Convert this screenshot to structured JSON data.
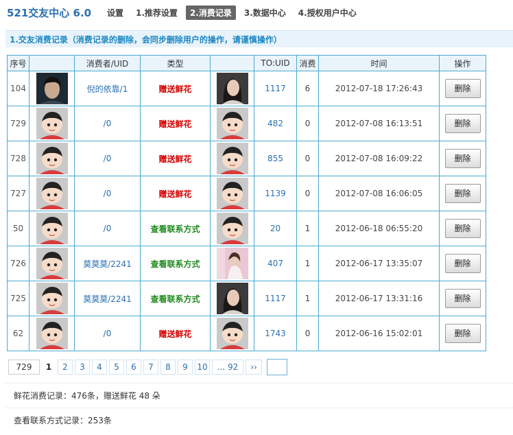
{
  "app": {
    "title": "521交友中心 6.0"
  },
  "nav": [
    {
      "label": "设置",
      "active": false
    },
    {
      "label": "1.推荐设置",
      "active": false
    },
    {
      "label": "2.消费记录",
      "active": true
    },
    {
      "label": "3.数据中心",
      "active": false
    },
    {
      "label": "4.授权用户中心",
      "active": false
    }
  ],
  "section": {
    "title": "1.交友消费记录（消费记录的删除，会同步删除用户的操作，请谨慎操作）"
  },
  "table": {
    "headers": [
      "序号",
      "",
      "消费者/UID",
      "类型",
      "",
      "TO:UID",
      "消费",
      "时间",
      "操作"
    ],
    "rows": [
      {
        "id": "104",
        "avatar": "photo-male",
        "user": "倪的依靠/1",
        "type": "赠送鲜花",
        "type_kind": "flower",
        "to_avatar": "photo-female",
        "touid": "1117",
        "amount": "6",
        "time": "2012-07-18 17:26:43",
        "action": "删除"
      },
      {
        "id": "729",
        "avatar": "cartoon-default",
        "user": "/0",
        "type": "赠送鲜花",
        "type_kind": "flower",
        "to_avatar": "cartoon-default",
        "touid": "482",
        "amount": "0",
        "time": "2012-07-08 16:13:51",
        "action": "删除"
      },
      {
        "id": "728",
        "avatar": "cartoon-default",
        "user": "/0",
        "type": "赠送鲜花",
        "type_kind": "flower",
        "to_avatar": "cartoon-default",
        "touid": "855",
        "amount": "0",
        "time": "2012-07-08 16:09:22",
        "action": "删除"
      },
      {
        "id": "727",
        "avatar": "cartoon-default",
        "user": "/0",
        "type": "赠送鲜花",
        "type_kind": "flower",
        "to_avatar": "cartoon-default",
        "touid": "1139",
        "amount": "0",
        "time": "2012-07-08 16:06:05",
        "action": "删除"
      },
      {
        "id": "50",
        "avatar": "cartoon-default",
        "user": "/0",
        "type": "查看联系方式",
        "type_kind": "contact",
        "to_avatar": "cartoon-default",
        "touid": "20",
        "amount": "1",
        "time": "2012-06-18 06:55:20",
        "action": "删除"
      },
      {
        "id": "726",
        "avatar": "cartoon-default",
        "user": "莫莫莫/2241",
        "type": "查看联系方式",
        "type_kind": "contact",
        "to_avatar": "photo-pink",
        "touid": "407",
        "amount": "1",
        "time": "2012-06-17 13:35:07",
        "action": "删除"
      },
      {
        "id": "725",
        "avatar": "cartoon-default",
        "user": "莫莫莫/2241",
        "type": "查看联系方式",
        "type_kind": "contact",
        "to_avatar": "photo-female",
        "touid": "1117",
        "amount": "1",
        "time": "2012-06-17 13:31:16",
        "action": "删除"
      },
      {
        "id": "62",
        "avatar": "cartoon-default",
        "user": "/0",
        "type": "赠送鲜花",
        "type_kind": "flower",
        "to_avatar": "cartoon-default",
        "touid": "1743",
        "amount": "0",
        "time": "2012-06-16 15:02:01",
        "action": "删除"
      }
    ]
  },
  "pagination": {
    "total": "729",
    "pages": [
      "1",
      "2",
      "3",
      "4",
      "5",
      "6",
      "7",
      "8",
      "9",
      "10",
      "... 92"
    ],
    "current": "1",
    "next": "››"
  },
  "stats": {
    "flowers": "鲜花消费记录：476条，赠送鲜花 48 朵",
    "contacts": "查看联系方式记录：253条"
  },
  "colors": {
    "accent": "#2a6fb0",
    "section_title": "#1b87c3",
    "table_border": "#4aa8d2",
    "flower_type": "#d40000",
    "contact_type": "#1f8a1f"
  }
}
